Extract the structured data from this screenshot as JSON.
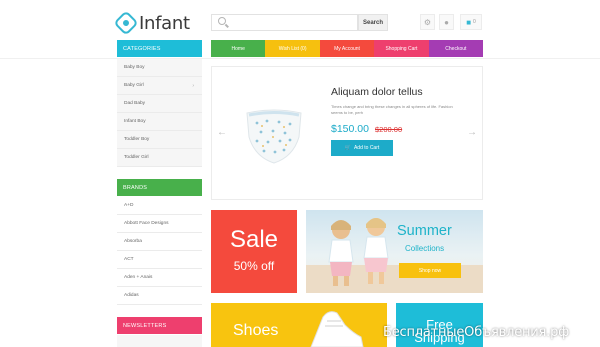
{
  "brand": {
    "logo_text": "Infant",
    "accent": "#35b8d3"
  },
  "header": {
    "search_button": "Search",
    "icons": [
      "settings-icon",
      "user-icon",
      "cart-icon"
    ],
    "cart_count": "0"
  },
  "nav": [
    {
      "label": "Home",
      "color": "#48b04b"
    },
    {
      "label": "Wish List (0)",
      "color": "#f6c00f"
    },
    {
      "label": "My Account",
      "color": "#f44a3d"
    },
    {
      "label": "Shopping Cart",
      "color": "#ee3f6e"
    },
    {
      "label": "Checkout",
      "color": "#a43cb3"
    }
  ],
  "sidebar": {
    "categories": {
      "title": "CATEGORIES",
      "color": "#1ebdd8",
      "items": [
        "Baby Boy",
        "Baby Girl",
        "Dad Baby",
        "Infant Boy",
        "Toddler Boy",
        "Toddler Girl"
      ]
    },
    "brands": {
      "title": "BRANDS",
      "color": "#48b04b",
      "items": [
        "A+D",
        "Abbott Face Designs",
        "Absorba",
        "ACT",
        "Aden + Anais",
        "Adidas"
      ]
    },
    "newsletters": {
      "title": "NEWSLETTERS",
      "color": "#ee3f6e"
    }
  },
  "slider": {
    "title": "Aliquam dolor tellus",
    "description": "Times change and bring these changes in all spheres of life. Fashion seems to be, perh",
    "price_new": "$150.00",
    "price_old": "$200.00",
    "add_to_cart": "Add to Cart"
  },
  "banners": {
    "sale": {
      "title": "Sale",
      "subtitle": "50% off"
    },
    "summer": {
      "title": "Summer",
      "subtitle": "Collections",
      "button": "Shop now"
    },
    "shoes": {
      "title": "Shoes"
    },
    "free": {
      "title": "Free\nShipping"
    }
  },
  "watermark": "БесплатныеОбъявления.рф"
}
